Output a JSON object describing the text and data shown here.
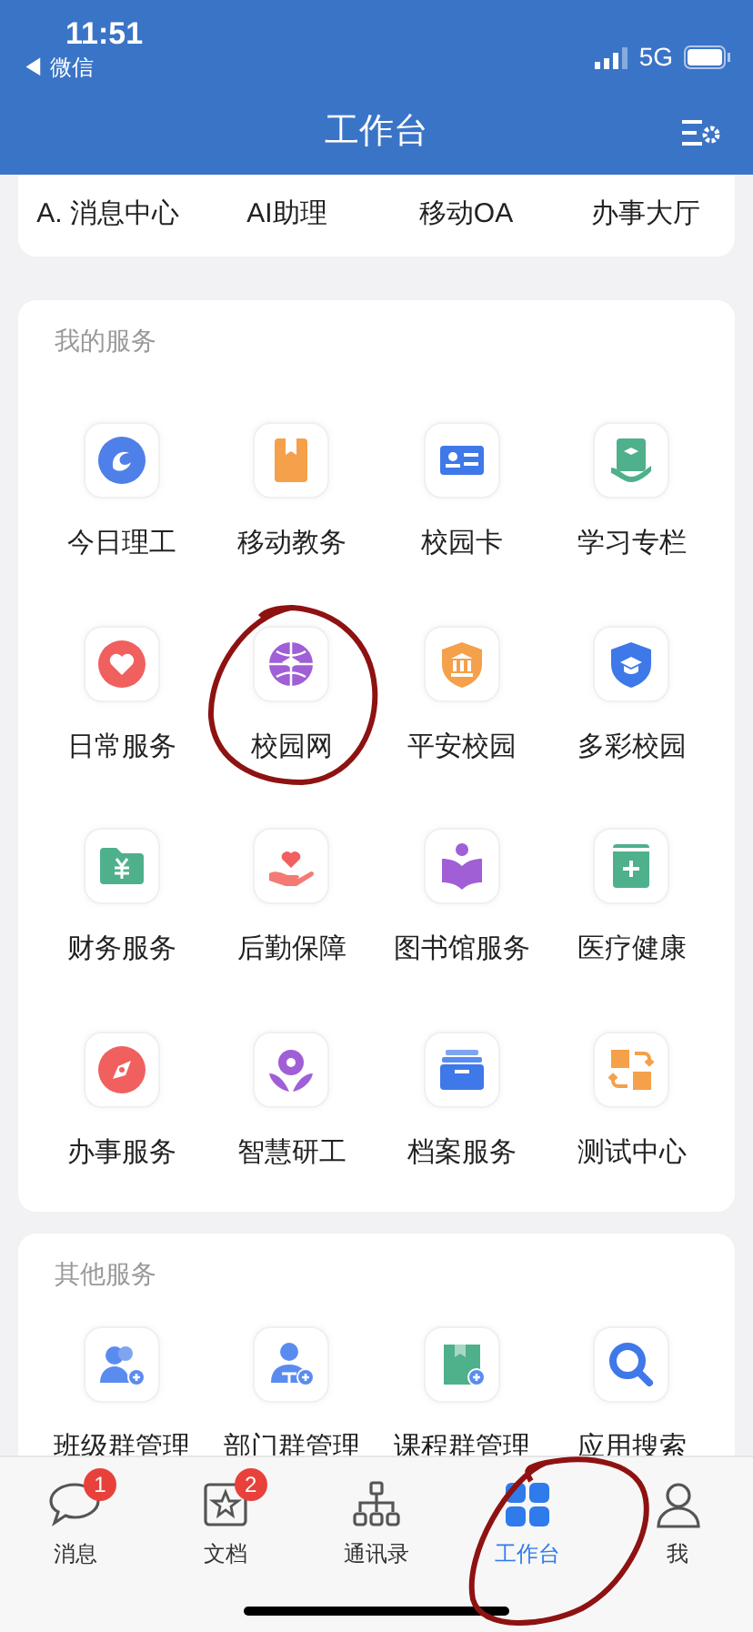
{
  "status_bar": {
    "time": "11:51",
    "back_app": "◀ 微信",
    "network": "5G"
  },
  "header": {
    "title": "工作台"
  },
  "quick_links": [
    "A. 消息中心",
    "AI助理",
    "移动OA",
    "办事大厅"
  ],
  "sections": [
    {
      "title": "我的服务",
      "items": [
        {
          "label": "今日理工"
        },
        {
          "label": "移动教务"
        },
        {
          "label": "校园卡"
        },
        {
          "label": "学习专栏"
        },
        {
          "label": "日常服务"
        },
        {
          "label": "校园网"
        },
        {
          "label": "平安校园"
        },
        {
          "label": "多彩校园"
        },
        {
          "label": "财务服务"
        },
        {
          "label": "后勤保障"
        },
        {
          "label": "图书馆服务"
        },
        {
          "label": "医疗健康"
        },
        {
          "label": "办事服务"
        },
        {
          "label": "智慧研工"
        },
        {
          "label": "档案服务"
        },
        {
          "label": "测试中心"
        }
      ]
    },
    {
      "title": "其他服务",
      "items": [
        {
          "label": "班级群管理"
        },
        {
          "label": "部门群管理"
        },
        {
          "label": "课程群管理"
        },
        {
          "label": "应用搜索"
        }
      ]
    }
  ],
  "tab_bar": [
    {
      "label": "消息",
      "badge": "1",
      "selected": false
    },
    {
      "label": "文档",
      "badge": "2",
      "selected": false
    },
    {
      "label": "通讯录",
      "selected": false
    },
    {
      "label": "工作台",
      "selected": true
    },
    {
      "label": "我",
      "selected": false
    }
  ]
}
